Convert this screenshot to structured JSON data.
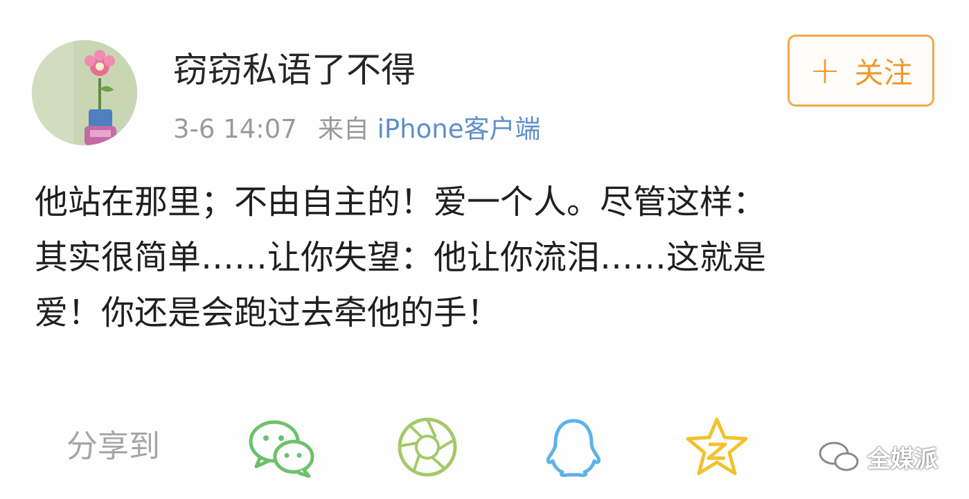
{
  "user": {
    "name": "窃窃私语了不得",
    "avatar_icon": "avatar-flower-pot"
  },
  "meta": {
    "time": "3-6 14:07",
    "from_label": "来自",
    "source": "iPhone客户端"
  },
  "follow": {
    "plus": "+",
    "label": "关注"
  },
  "post": {
    "lines": [
      "他站在那里；不由自主的！爱一个人。尽管这样：",
      "其实很简单……让你失望：他让你流泪……这就是",
      "爱！你还是会跑过去牵他的手！"
    ]
  },
  "share": {
    "label": "分享到",
    "icons": [
      "wechat-icon",
      "moments-icon",
      "qq-icon",
      "qzone-icon"
    ]
  },
  "watermark": {
    "text": "全媒派"
  },
  "colors": {
    "follow_accent": "#ee9a30",
    "source_link": "#5d8fc8",
    "wechat": "#6cc16a",
    "moments": "#a3c967",
    "qq": "#5db2e8",
    "qzone": "#f2c22e"
  }
}
